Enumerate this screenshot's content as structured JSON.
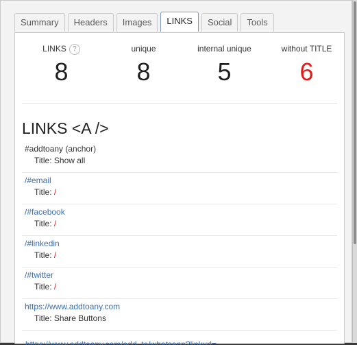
{
  "tabs": [
    {
      "label": "Summary"
    },
    {
      "label": "Headers"
    },
    {
      "label": "Images"
    },
    {
      "label": "LINKS"
    },
    {
      "label": "Social"
    },
    {
      "label": "Tools"
    }
  ],
  "stats": {
    "links_label": "LINKS",
    "links_value": "8",
    "unique_label": "unique",
    "unique_value": "8",
    "internal_label": "internal unique",
    "internal_value": "5",
    "without_title_label": "without TITLE",
    "without_title_value": "6",
    "help_glyph": "?",
    "accent_red": "#e11a1a"
  },
  "section_title": "LINKS <A />",
  "title_prefix": "Title:",
  "links": [
    {
      "url": "#addtoany (anchor)",
      "title": "Show all",
      "missing_title": false
    },
    {
      "url": "/#email",
      "title": "/",
      "missing_title": true
    },
    {
      "url": "/#facebook",
      "title": "/",
      "missing_title": true
    },
    {
      "url": "/#linkedin",
      "title": "/",
      "missing_title": true
    },
    {
      "url": "/#twitter",
      "title": "/",
      "missing_title": true
    },
    {
      "url": "https://www.addtoany.com",
      "title": "Share Buttons",
      "missing_title": false
    }
  ],
  "cutoff_text": "https://www.addtoany.com/add_to/whatsapp?linkurl=..."
}
